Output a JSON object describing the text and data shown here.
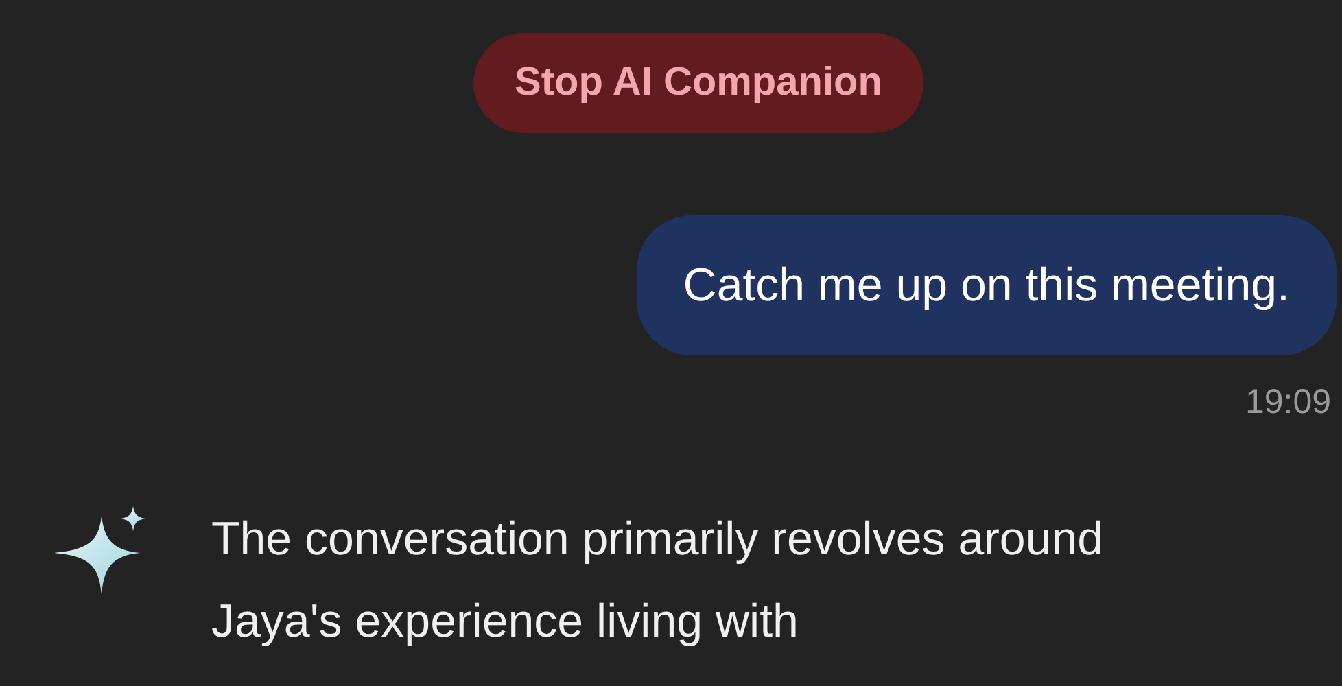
{
  "stop_button": {
    "label": "Stop AI Companion"
  },
  "messages": [
    {
      "kind": "user",
      "text": "Catch me up on this meeting.",
      "time": "19:09"
    },
    {
      "kind": "assistant",
      "text": "The conversation primarily revolves around Jaya's experience living with"
    }
  ]
}
